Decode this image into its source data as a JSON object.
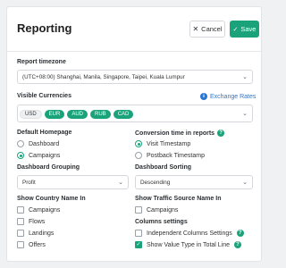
{
  "header": {
    "title": "Reporting",
    "cancel_label": "Cancel",
    "save_label": "Save"
  },
  "timezone": {
    "label": "Report timezone",
    "value": "(UTC+08:00) Shanghai, Manila, Singapore, Taipei, Kuala Lumpur"
  },
  "currencies": {
    "label": "Visible Currencies",
    "link": "Exchange Rates",
    "chips": [
      {
        "label": "USD",
        "selected": false
      },
      {
        "label": "EUR",
        "selected": true
      },
      {
        "label": "AUD",
        "selected": true
      },
      {
        "label": "RUB",
        "selected": true
      },
      {
        "label": "CAD",
        "selected": true
      }
    ]
  },
  "default_homepage": {
    "label": "Default Homepage",
    "options": [
      "Dashboard",
      "Campaigns"
    ],
    "selected": "Campaigns"
  },
  "conversion_time": {
    "label": "Conversion time in reports",
    "options": [
      "Visit Timestamp",
      "Postback Timestamp"
    ],
    "selected": "Visit Timestamp"
  },
  "dashboard_grouping": {
    "label": "Dashboard Grouping",
    "value": "Profit"
  },
  "dashboard_sorting": {
    "label": "Dashboard Sorting",
    "value": "Descending"
  },
  "country_name": {
    "label": "Show Country Name In",
    "options": [
      {
        "label": "Campaigns",
        "checked": false
      },
      {
        "label": "Flows",
        "checked": false
      },
      {
        "label": "Landings",
        "checked": false
      },
      {
        "label": "Offers",
        "checked": false
      }
    ]
  },
  "traffic_source": {
    "label": "Show Traffic Source Name In",
    "options": [
      {
        "label": "Campaigns",
        "checked": false
      }
    ]
  },
  "columns_settings": {
    "label": "Columns settings",
    "options": [
      {
        "label": "Independent Columns Settings",
        "checked": false
      },
      {
        "label": "Show Value Type in Total Line",
        "checked": true
      }
    ]
  },
  "colors": {
    "accent": "#1aa37a",
    "link": "#2a76d2"
  }
}
